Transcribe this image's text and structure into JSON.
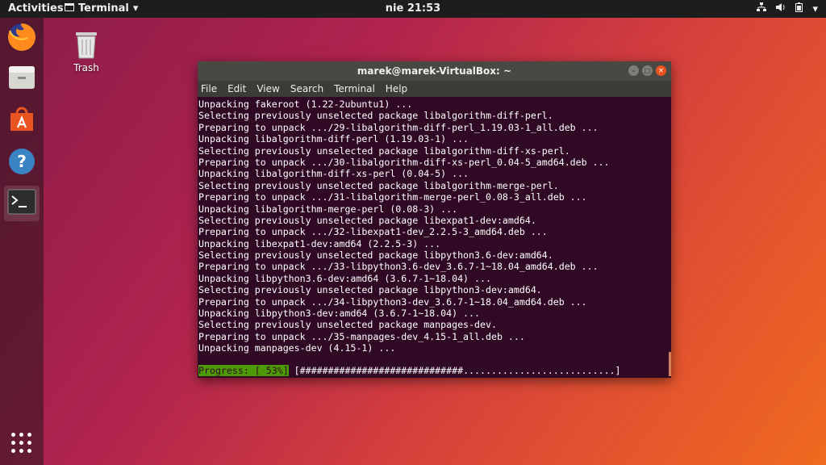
{
  "topbar": {
    "activities": "Activities",
    "app_menu": "Terminal",
    "clock": "nie 21:53"
  },
  "desktop": {
    "trash_label": "Trash"
  },
  "window": {
    "title": "marek@marek-VirtualBox: ~",
    "menu": [
      "File",
      "Edit",
      "View",
      "Search",
      "Terminal",
      "Help"
    ]
  },
  "terminal": {
    "lines": [
      "Unpacking fakeroot (1.22-2ubuntu1) ...",
      "Selecting previously unselected package libalgorithm-diff-perl.",
      "Preparing to unpack .../29-libalgorithm-diff-perl_1.19.03-1_all.deb ...",
      "Unpacking libalgorithm-diff-perl (1.19.03-1) ...",
      "Selecting previously unselected package libalgorithm-diff-xs-perl.",
      "Preparing to unpack .../30-libalgorithm-diff-xs-perl_0.04-5_amd64.deb ...",
      "Unpacking libalgorithm-diff-xs-perl (0.04-5) ...",
      "Selecting previously unselected package libalgorithm-merge-perl.",
      "Preparing to unpack .../31-libalgorithm-merge-perl_0.08-3_all.deb ...",
      "Unpacking libalgorithm-merge-perl (0.08-3) ...",
      "Selecting previously unselected package libexpat1-dev:amd64.",
      "Preparing to unpack .../32-libexpat1-dev_2.2.5-3_amd64.deb ...",
      "Unpacking libexpat1-dev:amd64 (2.2.5-3) ...",
      "Selecting previously unselected package libpython3.6-dev:amd64.",
      "Preparing to unpack .../33-libpython3.6-dev_3.6.7-1~18.04_amd64.deb ...",
      "Unpacking libpython3.6-dev:amd64 (3.6.7-1~18.04) ...",
      "Selecting previously unselected package libpython3-dev:amd64.",
      "Preparing to unpack .../34-libpython3-dev_3.6.7-1~18.04_amd64.deb ...",
      "Unpacking libpython3-dev:amd64 (3.6.7-1~18.04) ...",
      "Selecting previously unselected package manpages-dev.",
      "Preparing to unpack .../35-manpages-dev_4.15-1_all.deb ...",
      "Unpacking manpages-dev (4.15-1) ..."
    ],
    "progress_label": "Progress: [ 53%]",
    "progress_bar": " [#############################...........................]",
    "progress_percent": 53
  },
  "icons": {
    "dock": [
      "firefox-icon",
      "files-icon",
      "software-icon",
      "help-icon",
      "terminal-icon"
    ],
    "tray": [
      "network-icon",
      "volume-icon",
      "battery-icon",
      "power-menu-icon"
    ]
  },
  "colors": {
    "terminal_bg": "#300a24",
    "progress_green": "#4e9a06",
    "accent_orange": "#e95420"
  }
}
